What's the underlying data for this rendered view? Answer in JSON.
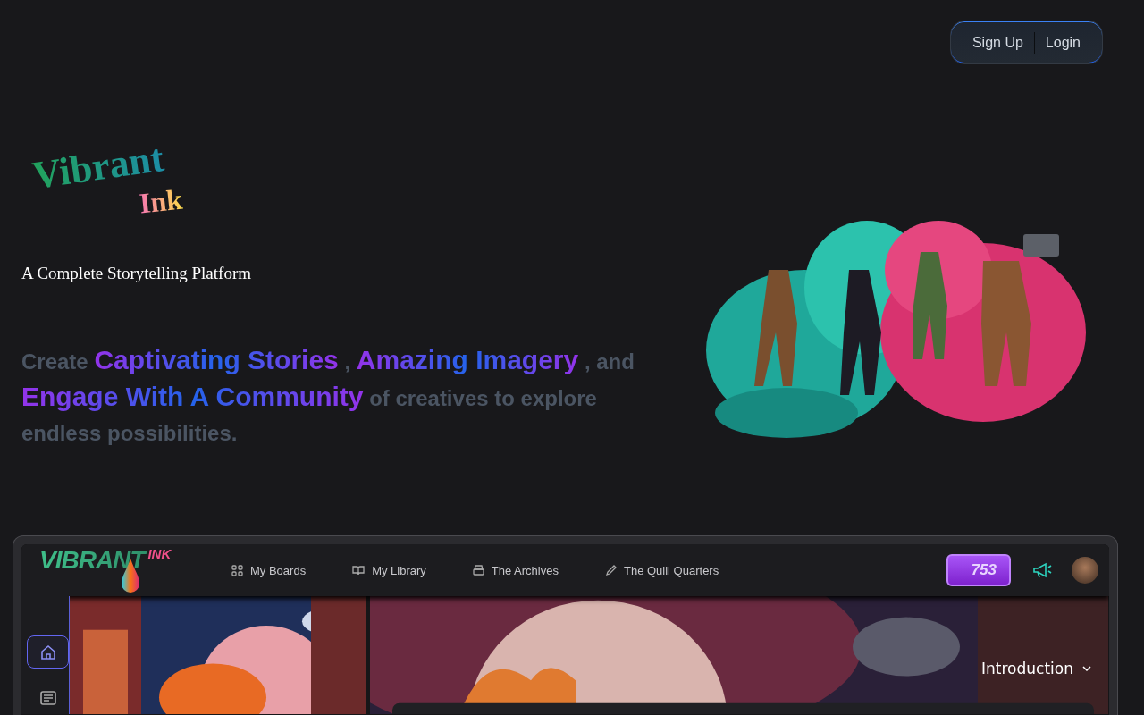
{
  "auth": {
    "buttons": [
      {
        "label": "Sign Up"
      },
      {
        "label": "Login"
      }
    ]
  },
  "hero": {
    "logo": {
      "line_1": "Vibrant",
      "line_2": "Ink"
    },
    "tagline": "A Complete Storytelling Platform",
    "pitch": [
      {
        "text": "Create",
        "kind": "plain"
      },
      {
        "text": "Captivating Stories",
        "kind": "highlight"
      },
      {
        "text": ",",
        "kind": "plain"
      },
      {
        "text": "Amazing Imagery",
        "kind": "highlight"
      },
      {
        "text": ", and",
        "kind": "plain"
      },
      {
        "text": "Engage With A Community",
        "kind": "highlight"
      },
      {
        "text": "of creatives to explore endless possibilities.",
        "kind": "plain"
      }
    ]
  },
  "preview": {
    "logo": {
      "line_1": "VIBRANT",
      "line_2": "INK"
    },
    "nav": [
      {
        "label": "My Boards"
      },
      {
        "label": "My Library"
      },
      {
        "label": "The Archives"
      },
      {
        "label": "The Quill Quarters"
      }
    ],
    "credits": "753",
    "sidebar": [
      {
        "selected": true
      },
      {
        "selected": false
      }
    ],
    "section": {
      "label": "Introduction"
    }
  }
}
